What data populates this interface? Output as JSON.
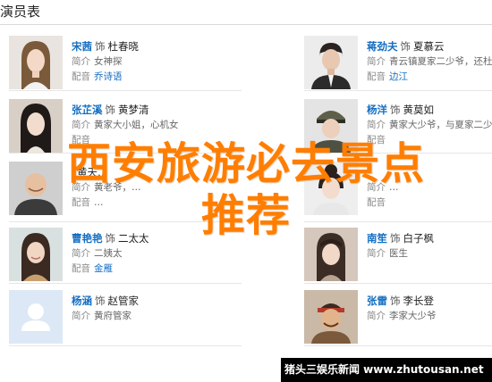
{
  "section_title": "演员表",
  "cards": [
    {
      "actor": "宋茜",
      "plays": "饰",
      "role": "杜春晓",
      "k1": "简介",
      "v1": "女神探",
      "k2": "配音",
      "v2": "乔诗语",
      "v2_link": true,
      "photo": "female-long-hair-portrait"
    },
    {
      "actor": "蒋劲夫",
      "plays": "饰",
      "role": "夏慕云",
      "k1": "简介",
      "v1": "青云镇夏家二少爷，还杜春晓",
      "k2": "配音",
      "v2": "边江",
      "v2_link": true,
      "photo": "male-dark-suit-portrait"
    },
    {
      "actor": "张芷溪",
      "plays": "饰",
      "role": "黄梦清",
      "k1": "简介",
      "v1": "黄家大小姐，心机女",
      "k2": "配音",
      "v2": "",
      "v2_link": false,
      "photo": "female-dark-hair-portrait"
    },
    {
      "actor": "杨洋",
      "plays": "饰",
      "role": "黄莫如",
      "k1": "简介",
      "v1": "黄家大少爷，与夏家二少爷",
      "k2": "配音",
      "v2": "",
      "v2_link": false,
      "photo": "male-military-cap-portrait"
    },
    {
      "actor": "",
      "plays": "",
      "role": "黄天…",
      "k1": "简介",
      "v1": "黄老爷，…",
      "k2": "配音",
      "v2": "…",
      "v2_link": false,
      "photo": "male-bald-smiling-portrait"
    },
    {
      "actor": "",
      "plays": "",
      "role": "",
      "k1": "简介",
      "v1": "…",
      "k2": "配音",
      "v2": "",
      "v2_link": false,
      "photo": "female-hair-bun-portrait"
    },
    {
      "actor": "曹艳艳",
      "plays": "饰",
      "role": "二太太",
      "k1": "简介",
      "v1": "二姨太",
      "k2": "配音",
      "v2": "金雁",
      "v2_link": true,
      "photo": "female-smiling-portrait"
    },
    {
      "actor": "南笙",
      "plays": "饰",
      "role": "白子枫",
      "k1": "简介",
      "v1": "医生",
      "k2": "",
      "v2": "",
      "v2_link": false,
      "photo": "female-bangs-portrait"
    },
    {
      "actor": "杨涵",
      "plays": "饰",
      "role": "赵管家",
      "k1": "简介",
      "v1": "黄府管家",
      "k2": "",
      "v2": "",
      "v2_link": false,
      "photo": "default-avatar"
    },
    {
      "actor": "张雷",
      "plays": "饰",
      "role": "李长登",
      "k1": "简介",
      "v1": "李家大少爷",
      "k2": "",
      "v2": "",
      "v2_link": false,
      "photo": "male-headband-portrait"
    }
  ],
  "overlay_line1": "西安旅游必去景点",
  "overlay_line2": "推荐",
  "watermark": "猪头三娱乐新闻 www.zhutousan.net",
  "colors": {
    "link": "#136ec2",
    "overlay": "#ff7e00"
  }
}
